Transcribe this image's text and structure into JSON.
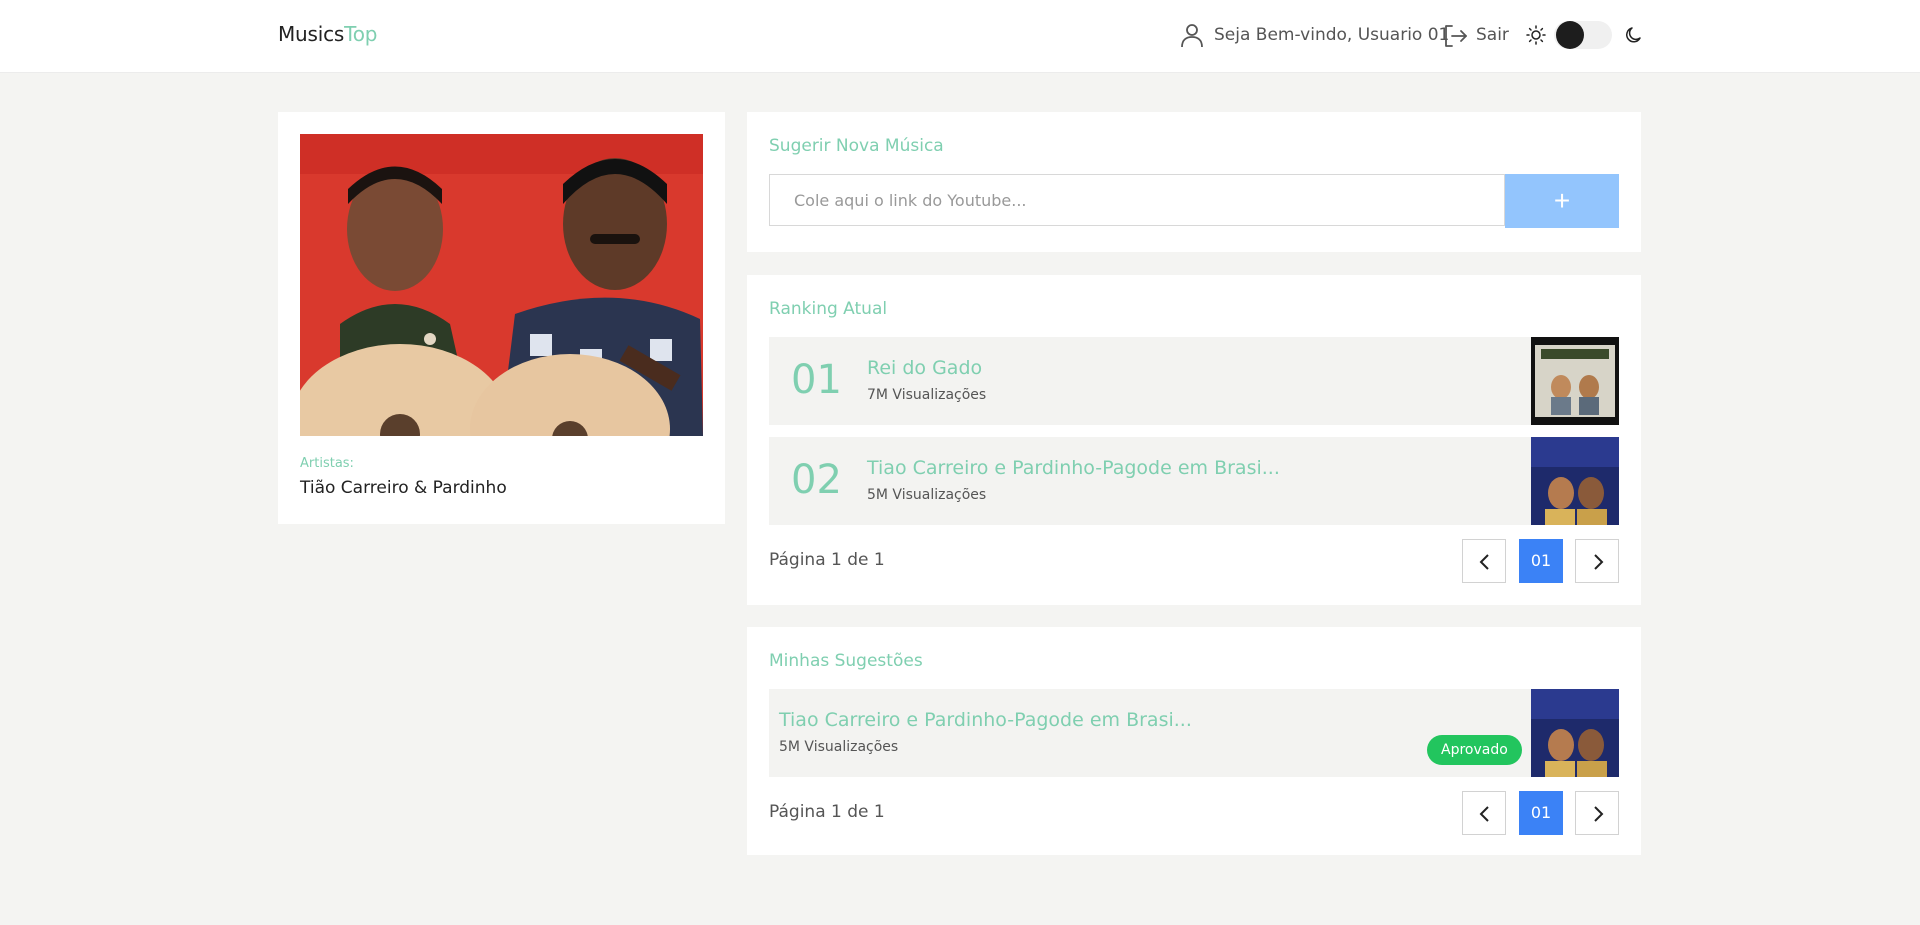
{
  "header": {
    "logo_part1": "Musics",
    "logo_part2": "Top",
    "welcome": "Seja Bem-vindo, Usuario 01",
    "logout": "Sair",
    "theme_toggle": "dark"
  },
  "artist": {
    "label": "Artistas:",
    "name": "Tião Carreiro & Pardinho"
  },
  "suggest": {
    "title": "Sugerir Nova Música",
    "placeholder": "Cole aqui o link do Youtube...",
    "add_label": "+"
  },
  "ranking": {
    "title": "Ranking Atual",
    "items": [
      {
        "rank": "01",
        "title": "Rei do Gado",
        "views": "7M Visualizações"
      },
      {
        "rank": "02",
        "title": "Tiao Carreiro e Pardinho-Pagode em Brasi...",
        "views": "5M Visualizações"
      }
    ],
    "pagination": {
      "label": "Página 1 de 1",
      "current": "01"
    }
  },
  "mine": {
    "title": "Minhas Sugestões",
    "items": [
      {
        "title": "Tiao Carreiro e Pardinho-Pagode em Brasi...",
        "views": "5M Visualizações",
        "status": "Aprovado"
      }
    ],
    "pagination": {
      "label": "Página 1 de 1",
      "current": "01"
    }
  },
  "colors": {
    "accent": "#7fcfb0",
    "primary": "#3b82f6",
    "primary_light": "#93c5fd",
    "approved": "#22c55e",
    "background": "#f4f4f2"
  },
  "icons": [
    "user-icon",
    "logout-icon",
    "sun-icon",
    "moon-icon",
    "chevron-left-icon",
    "chevron-right-icon"
  ]
}
